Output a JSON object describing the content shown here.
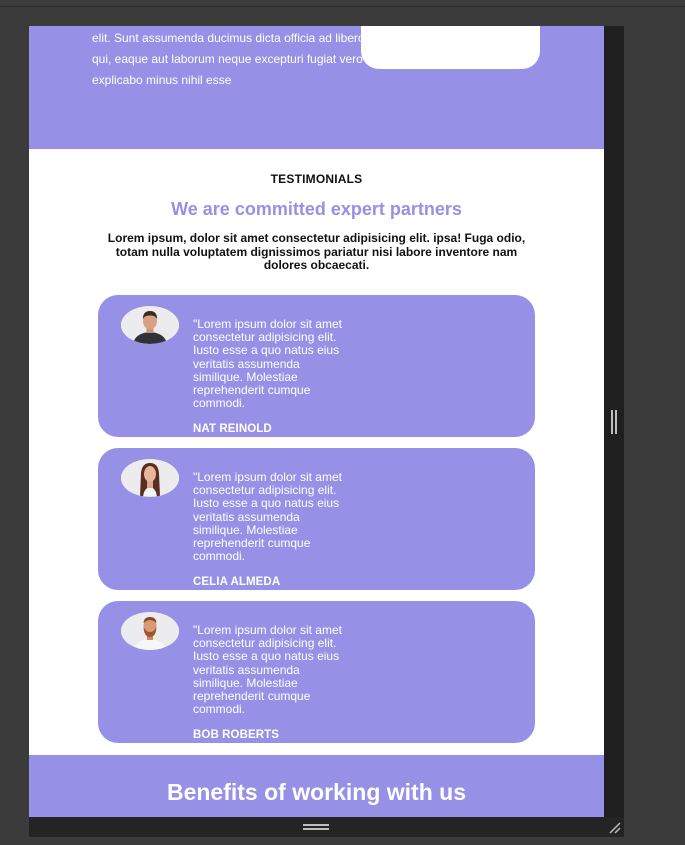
{
  "hero": {
    "text": "elit. Sunt assumenda ducimus dicta officia ad libero, qui, eaque aut laborum neque excepturi fugiat vero explicabo minus nihil esse"
  },
  "testimonials": {
    "eyebrow": "TESTIMONIALS",
    "heading": "We are committed expert partners",
    "intro": "Lorem ipsum, dolor sit amet consectetur adipisicing elit. ipsa! Fuga odio, totam nulla voluptatem dignissimos pariatur nisi labore inventore nam dolores obcaecati.",
    "items": [
      {
        "quote": "\"Lorem ipsum dolor sit amet consectetur adipisicing elit. Iusto esse a quo natus eius veritatis assumenda similique. Molestiae reprehenderit cumque commodi.",
        "name": "NAT REINOLD",
        "avatar": "man-portrait"
      },
      {
        "quote": "\"Lorem ipsum dolor sit amet consectetur adipisicing elit. Iusto esse a quo natus eius veritatis assumenda similique. Molestiae reprehenderit cumque commodi.",
        "name": "CELIA ALMEDA",
        "avatar": "woman-portrait"
      },
      {
        "quote": "\"Lorem ipsum dolor sit amet consectetur adipisicing elit. Iusto esse a quo natus eius veritatis assumenda similique. Molestiae reprehenderit cumque commodi.",
        "name": "BOB ROBERTS",
        "avatar": "bearded-man-portrait"
      }
    ]
  },
  "benefits": {
    "title": "Benefits of working with us"
  },
  "colors": {
    "accent": "#9691e6",
    "page_bg": "#ffffff",
    "editor_bg": "#3b3b3b"
  }
}
